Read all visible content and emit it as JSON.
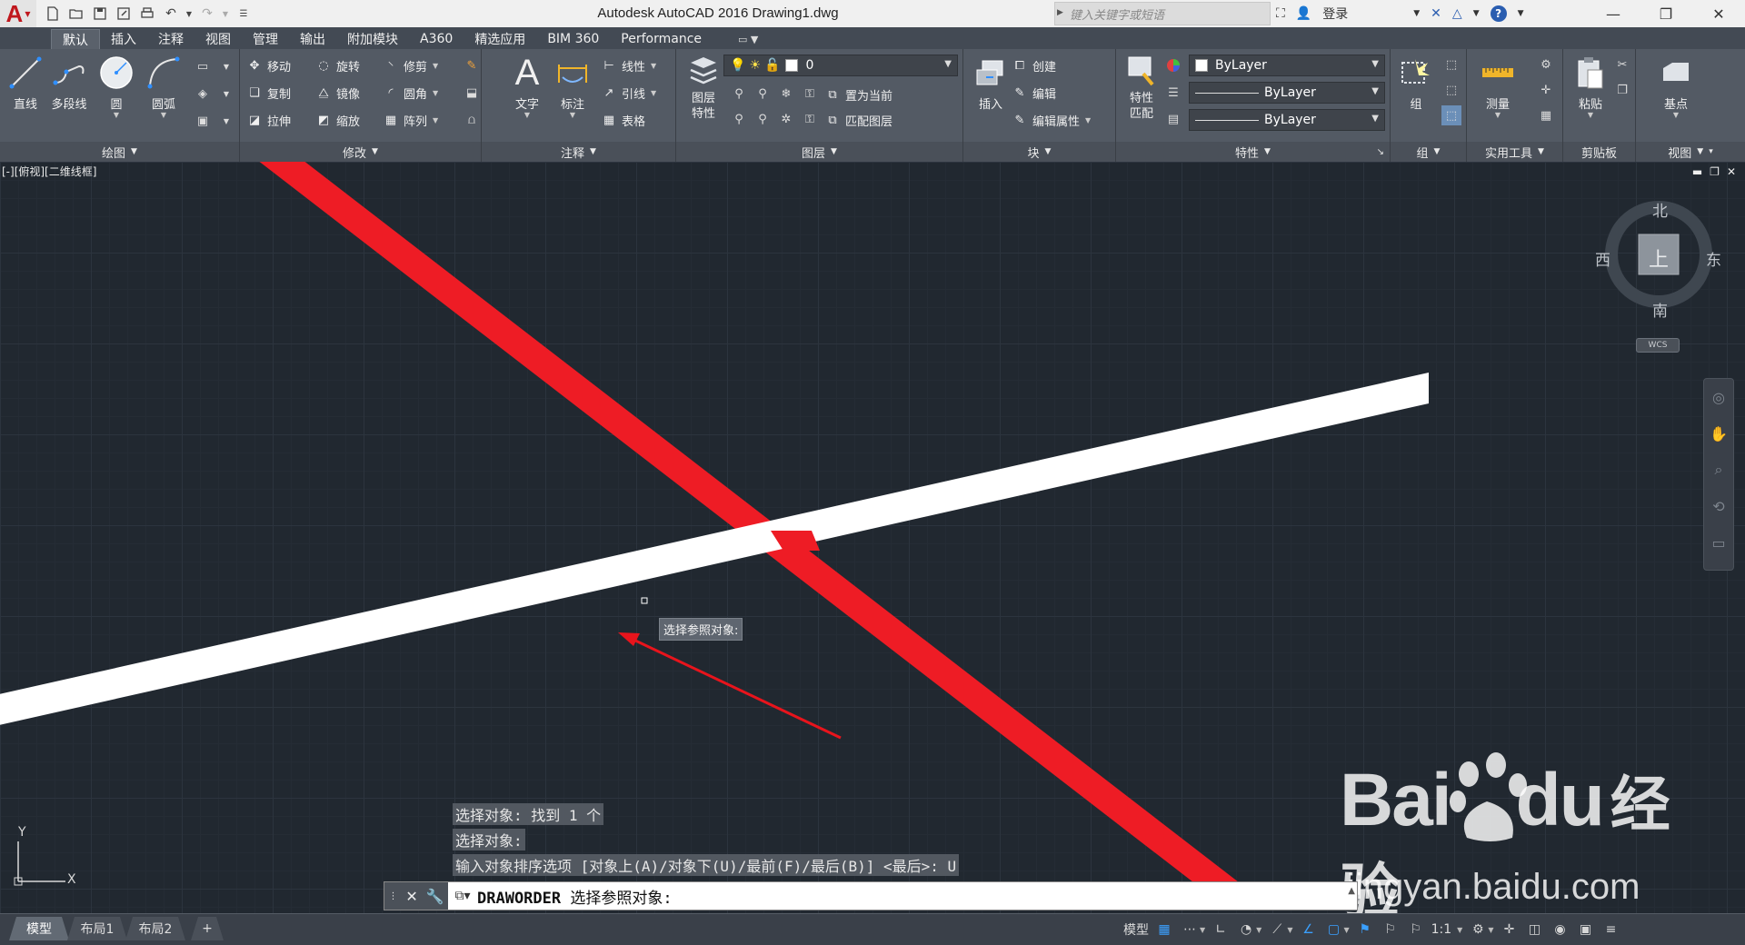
{
  "titlebar": {
    "title": "Autodesk AutoCAD 2016    Drawing1.dwg",
    "search_placeholder": "键入关键字或短语",
    "login_label": "登录",
    "help_label": "?"
  },
  "ribbon_tabs": [
    "默认",
    "插入",
    "注释",
    "视图",
    "管理",
    "输出",
    "附加模块",
    "A360",
    "精选应用",
    "BIM 360",
    "Performance"
  ],
  "panels": {
    "draw": {
      "title": "绘图",
      "line": "直线",
      "polyline": "多段线",
      "circle": "圆",
      "arc": "圆弧"
    },
    "modify": {
      "title": "修改",
      "move": "移动",
      "rotate": "旋转",
      "trim": "修剪",
      "copy": "复制",
      "mirror": "镜像",
      "fillet": "圆角",
      "stretch": "拉伸",
      "scale": "缩放",
      "array": "阵列"
    },
    "annotation": {
      "title": "注释",
      "text": "文字",
      "dimension": "标注",
      "linear": "线性",
      "leader": "引线",
      "table": "表格"
    },
    "layers": {
      "title": "图层",
      "layer_properties": "图层\n特性",
      "layer_props_line1": "图层",
      "layer_props_line2": "特性",
      "current_layer": "0",
      "set_current": "置为当前",
      "match_layer": "匹配图层"
    },
    "block": {
      "title": "块",
      "insert": "插入",
      "create": "创建",
      "edit": "编辑",
      "edit_attributes": "编辑属性"
    },
    "properties": {
      "title": "特性",
      "match_line1": "特性",
      "match_line2": "匹配",
      "color": "ByLayer",
      "linetype": "ByLayer",
      "lineweight": "ByLayer"
    },
    "groups": {
      "title": "组",
      "group": "组"
    },
    "utilities": {
      "title": "实用工具",
      "measure": "测量"
    },
    "clipboard": {
      "title": "剪贴板",
      "paste": "粘贴"
    },
    "view": {
      "title": "视图",
      "base": "基点"
    }
  },
  "viewport": {
    "label": "[-][俯视][二维线框]",
    "tooltip": "选择参照对象:"
  },
  "viewcube": {
    "north": "北",
    "south": "南",
    "east": "东",
    "west": "西",
    "face": "上",
    "wcs": "WCS"
  },
  "ucs": {
    "x": "X",
    "y": "Y"
  },
  "command_history": [
    "选择对象: 找到 1 个",
    "选择对象:",
    "输入对象排序选项 [对象上(A)/对象下(U)/最前(F)/最后(B)] <最后>: U"
  ],
  "command_line": {
    "command": "DRAWORDER",
    "prompt": "选择参照对象:"
  },
  "status": {
    "tabs": [
      "模型",
      "布局1",
      "布局2"
    ],
    "add_tab": "+",
    "model_label": "模型",
    "scale": "1:1"
  },
  "watermark": {
    "logo": "Bai",
    "logo2": "du",
    "cn": "经验",
    "site": "jingyan.baidu.com"
  },
  "colors": {
    "red_line": "#ee1c25",
    "white_line": "#ffffff",
    "arrow": "#e8141c",
    "canvas_bg": "#212830",
    "ribbon_bg": "#535a64",
    "accent_blue": "#3aa0ff"
  }
}
